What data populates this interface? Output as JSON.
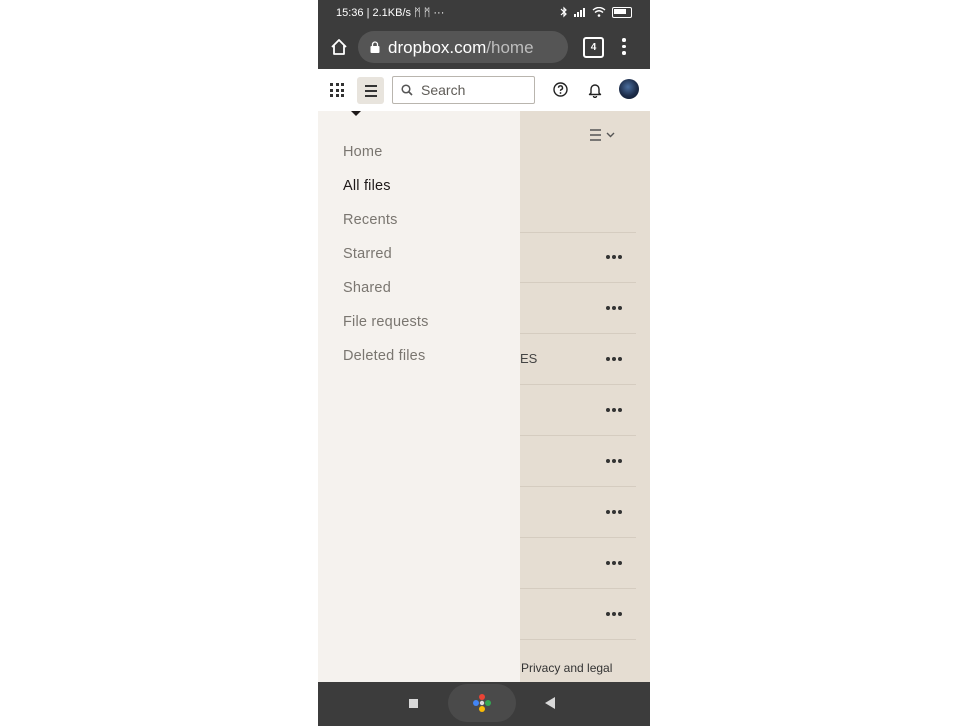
{
  "status_bar": {
    "time_info": "15:36 | 2.1KB/s ᛗ ᛗ ···"
  },
  "browser": {
    "url_domain": "dropbox.com",
    "url_path": "/home",
    "tab_count": "4"
  },
  "header": {
    "search_placeholder": "Search"
  },
  "sidebar": {
    "items": [
      {
        "label": "Home"
      },
      {
        "label": "All files"
      },
      {
        "label": "Recents"
      },
      {
        "label": "Starred"
      },
      {
        "label": "Shared"
      },
      {
        "label": "File requests"
      },
      {
        "label": "Deleted files"
      }
    ],
    "active": "All files"
  },
  "content": {
    "row_fragment": "ES",
    "footer_link": "Privacy and legal"
  },
  "colors": {
    "system_bar": "#3c3c3c",
    "drawer_bg": "#f5f2ee",
    "content_bg": "#e5ddd2",
    "active_text": "#1e1919",
    "inactive_text": "#7a7670"
  },
  "icons": [
    "home-icon",
    "lock-icon",
    "tabs-icon",
    "menu-icon",
    "apps-grid-icon",
    "hamburger-icon",
    "search-icon",
    "help-icon",
    "bell-icon",
    "avatar",
    "view-toggle-icon",
    "more-icon",
    "stop-icon",
    "assistant-icon",
    "back-icon"
  ]
}
